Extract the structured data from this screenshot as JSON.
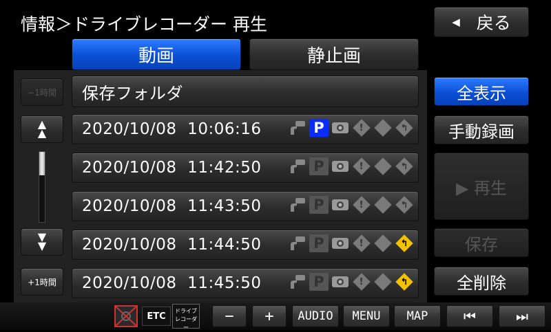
{
  "header": {
    "title": "情報＞ドライブレコーダー 再生",
    "back_label": "戻る"
  },
  "tabs": [
    {
      "label": "動画",
      "active": true
    },
    {
      "label": "静止画",
      "active": false
    }
  ],
  "left_nav": {
    "minus_hour": "−1時間",
    "plus_hour": "+1時間",
    "up": "⏶",
    "down": "⏷"
  },
  "folder": {
    "label": "保存フォルダ"
  },
  "rows": [
    {
      "datetime": "2020/10/08  10:06:16",
      "parking": true,
      "turn_yellow": false
    },
    {
      "datetime": "2020/10/08  11:42:50",
      "parking": false,
      "turn_yellow": false
    },
    {
      "datetime": "2020/10/08  11:43:50",
      "parking": false,
      "turn_yellow": false
    },
    {
      "datetime": "2020/10/08  11:44:50",
      "parking": false,
      "turn_yellow": true
    },
    {
      "datetime": "2020/10/08  11:45:50",
      "parking": false,
      "turn_yellow": true
    }
  ],
  "actions": {
    "show_all": "全表示",
    "manual_record": "手動録画",
    "play": "▶ 再生",
    "save": "保存",
    "delete_all": "全削除"
  },
  "bottom_bar": {
    "etc": "ETC",
    "drive_rec_top": "ドライブ",
    "drive_rec_bottom": "レコーダー",
    "minus": "−",
    "plus": "+",
    "audio": "AUDIO",
    "menu": "MENU",
    "map": "MAP",
    "prev": "⏮",
    "next": "⏭"
  },
  "icons": {
    "parking_letter": "P",
    "exclaim": "!",
    "arrow": "↰"
  },
  "colors": {
    "accent_blue": "#0a4fd6",
    "parking_blue": "#0a2cff",
    "warning_yellow": "#f2c200"
  }
}
